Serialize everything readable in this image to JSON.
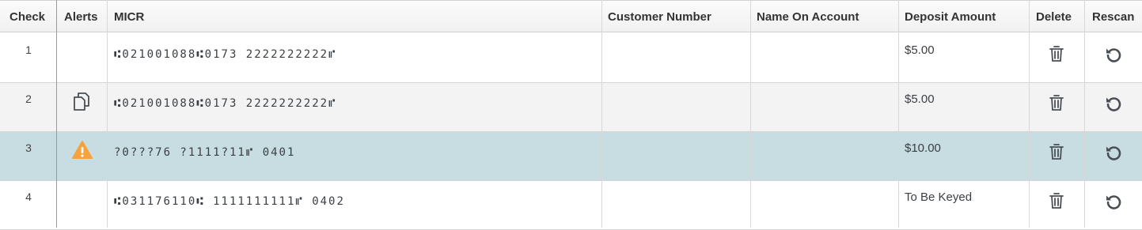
{
  "columns": {
    "check": "Check",
    "alerts": "Alerts",
    "micr": "MICR",
    "customer_number": "Customer Number",
    "name_on_account": "Name On Account",
    "deposit_amount": "Deposit Amount",
    "delete": "Delete",
    "rescan": "Rescan"
  },
  "rows": [
    {
      "check": "1",
      "alert": "",
      "micr": "⑆021001088⑆0173  2222222222⑈",
      "customer_number": "",
      "name_on_account": "",
      "deposit_amount": "$5.00",
      "state": "normal"
    },
    {
      "check": "2",
      "alert": "duplicate-icon",
      "micr": "⑆021001088⑆0173  2222222222⑈",
      "customer_number": "",
      "name_on_account": "",
      "deposit_amount": "$5.00",
      "state": "alternate"
    },
    {
      "check": "3",
      "alert": "warning-icon",
      "micr": "?0???76  ?1111?11⑈ 0401",
      "customer_number": "",
      "name_on_account": "",
      "deposit_amount": "$10.00",
      "state": "selected"
    },
    {
      "check": "4",
      "alert": "",
      "micr": "⑆031176110⑆ 1111111111⑈ 0402",
      "customer_number": "",
      "name_on_account": "",
      "deposit_amount": "To Be Keyed",
      "state": "normal"
    }
  ],
  "colors": {
    "selected_row": "#c7dde1",
    "alternate_row": "#f3f3f3",
    "warning": "#f5a33a",
    "icon": "#4a4f55"
  }
}
